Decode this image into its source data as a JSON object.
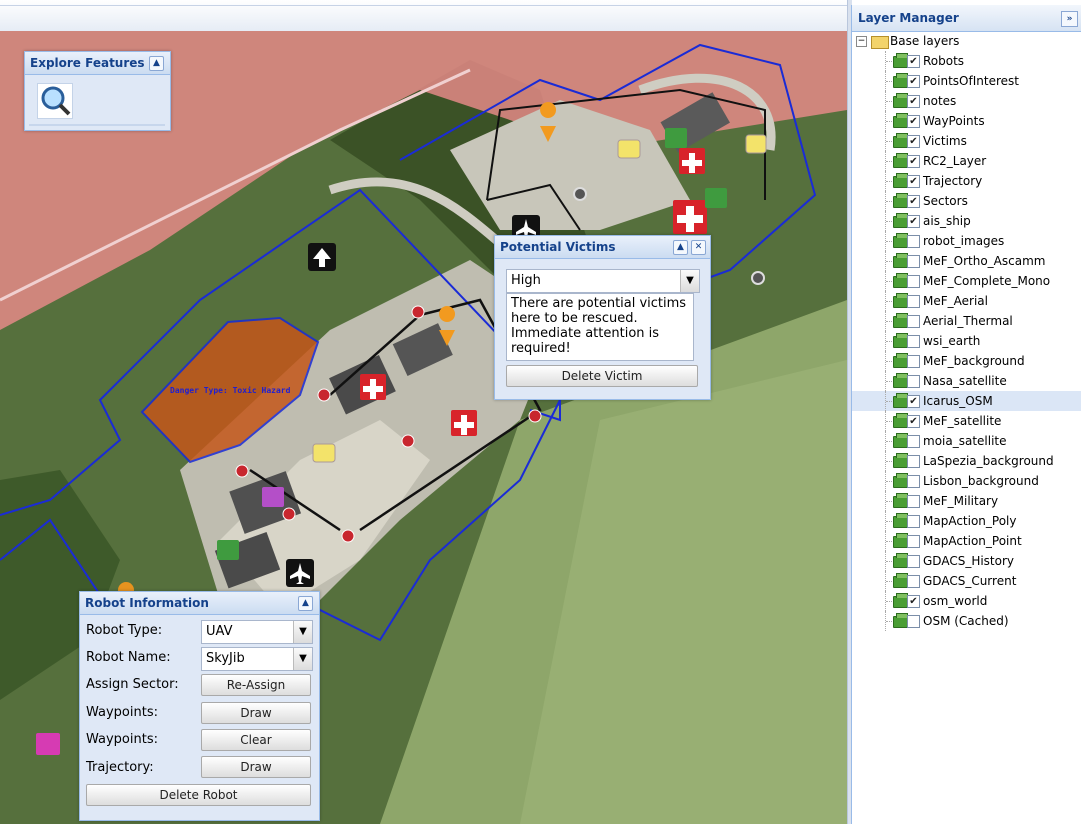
{
  "map": {
    "hazard_label": "Danger Type: Toxic Hazard"
  },
  "explore": {
    "title": "Explore Features",
    "collapse_icon": "chevron-up-icon",
    "feature_icon": "magnifier-icon"
  },
  "victims": {
    "title": "Potential Victims",
    "priority_selected": "High",
    "description": "There are potential victims here to be rescued. Immediate attention is required!",
    "delete_label": "Delete Victim"
  },
  "robot": {
    "title": "Robot Information",
    "type_label": "Robot Type:",
    "type_value": "UAV",
    "name_label": "Robot Name:",
    "name_value": "SkyJib",
    "sector_label": "Assign Sector:",
    "sector_button": "Re-Assign",
    "waypoints_label_1": "Waypoints:",
    "waypoints_draw": "Draw",
    "waypoints_label_2": "Waypoints:",
    "waypoints_clear": "Clear",
    "trajectory_label": "Trajectory:",
    "trajectory_draw": "Draw",
    "delete_label": "Delete Robot"
  },
  "layer_manager": {
    "title": "Layer Manager",
    "root_label": "Base layers",
    "layers": [
      {
        "name": "Robots",
        "checked": true
      },
      {
        "name": "PointsOfInterest",
        "checked": true
      },
      {
        "name": "notes",
        "checked": true
      },
      {
        "name": "WayPoints",
        "checked": true
      },
      {
        "name": "Victims",
        "checked": true
      },
      {
        "name": "RC2_Layer",
        "checked": true
      },
      {
        "name": "Trajectory",
        "checked": true
      },
      {
        "name": "Sectors",
        "checked": true
      },
      {
        "name": "ais_ship",
        "checked": true
      },
      {
        "name": "robot_images",
        "checked": false
      },
      {
        "name": "MeF_Ortho_Ascamm",
        "checked": false
      },
      {
        "name": "MeF_Complete_Mono",
        "checked": false
      },
      {
        "name": "MeF_Aerial",
        "checked": false
      },
      {
        "name": "Aerial_Thermal",
        "checked": false
      },
      {
        "name": "wsi_earth",
        "checked": false
      },
      {
        "name": "MeF_background",
        "checked": false
      },
      {
        "name": "Nasa_satellite",
        "checked": false
      },
      {
        "name": "Icarus_OSM",
        "checked": true,
        "selected": true
      },
      {
        "name": "MeF_satellite",
        "checked": true
      },
      {
        "name": "moia_satellite",
        "checked": false
      },
      {
        "name": "LaSpezia_background",
        "checked": false
      },
      {
        "name": "Lisbon_background",
        "checked": false
      },
      {
        "name": "MeF_Military",
        "checked": false
      },
      {
        "name": "MapAction_Poly",
        "checked": false
      },
      {
        "name": "MapAction_Point",
        "checked": false
      },
      {
        "name": "GDACS_History",
        "checked": false
      },
      {
        "name": "GDACS_Current",
        "checked": false
      },
      {
        "name": "osm_world",
        "checked": true
      },
      {
        "name": "OSM (Cached)",
        "checked": false
      }
    ]
  },
  "colors": {
    "panel_title": "#15428b",
    "panel_border": "#99bbe8",
    "sector_line": "#1a2bd6",
    "hazard_fill": "#c4571a",
    "danger_zone": "#e88888"
  }
}
